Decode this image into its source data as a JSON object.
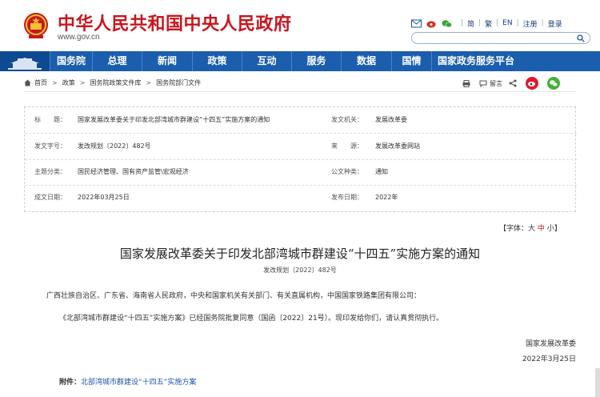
{
  "header": {
    "site_title": "中华人民共和国中央人民政府",
    "site_url": "www.gov.cn",
    "top_links": [
      "简",
      "繁",
      "EN",
      "注册",
      "登录"
    ],
    "search_placeholder": ""
  },
  "nav": {
    "items": [
      "国务院",
      "总理",
      "新闻",
      "政策",
      "互动",
      "服务",
      "数据",
      "国情",
      "国家政务服务平台"
    ]
  },
  "breadcrumb": [
    "首页",
    "政策",
    "国务院政策文件库",
    "国务院部门文件"
  ],
  "tools": {
    "comment": "留言"
  },
  "info": {
    "title_label": "标　　题：",
    "title_value": "国家发展改革委关于印发北部湾城市群建设“十四五”实施方案的通知",
    "issuer_label": "发文机关：",
    "issuer_value": "发展改革委",
    "doc_no_label": "发文字号：",
    "doc_no_value": "发改规划〔2022〕482号",
    "source_label": "来　　源：",
    "source_value": "发展改革委网站",
    "topic_label": "主题分类：",
    "topic_value": "国民经济管理、国有资产监管\\宏观经济",
    "type_label": "公文种类：",
    "type_value": "通知",
    "written_label": "成文日期：",
    "written_value": "2022年03月25日",
    "published_label": "发布日期：",
    "published_value": "2022年"
  },
  "fontsize": {
    "prefix": "【字体：",
    "big": "大",
    "mid": "中",
    "small": "小",
    "suffix": "】"
  },
  "document": {
    "title": "国家发展改革委关于印发北部湾城市群建设“十四五”实施方案的通知",
    "number": "发改规划〔2022〕482号",
    "addressee": "广西壮族自治区、广东省、海南省人民政府，中央和国家机关有关部门、有关直属机构，中国国家铁路集团有限公司：",
    "paragraph": "《北部湾城市群建设“十四五”实施方案》已经国务院批复同意（国函〔2022〕21号）。现印发给你们，请认真贯彻执行。",
    "signer": "国家发展改革委",
    "date": "2022年3月25日",
    "attachment_label": "附件：",
    "attachment_link": "北部湾城市群建设“十四五”实施方案"
  },
  "colors": {
    "brand_red": "#c8161e",
    "nav_blue": "#1b5eae",
    "link_blue": "#1a56a8"
  },
  "icons": [
    "national-emblem-icon",
    "mail-icon",
    "weibo-icon",
    "wechat-icon",
    "home-icon",
    "print-icon",
    "comment-icon",
    "share-icon",
    "search-icon"
  ]
}
